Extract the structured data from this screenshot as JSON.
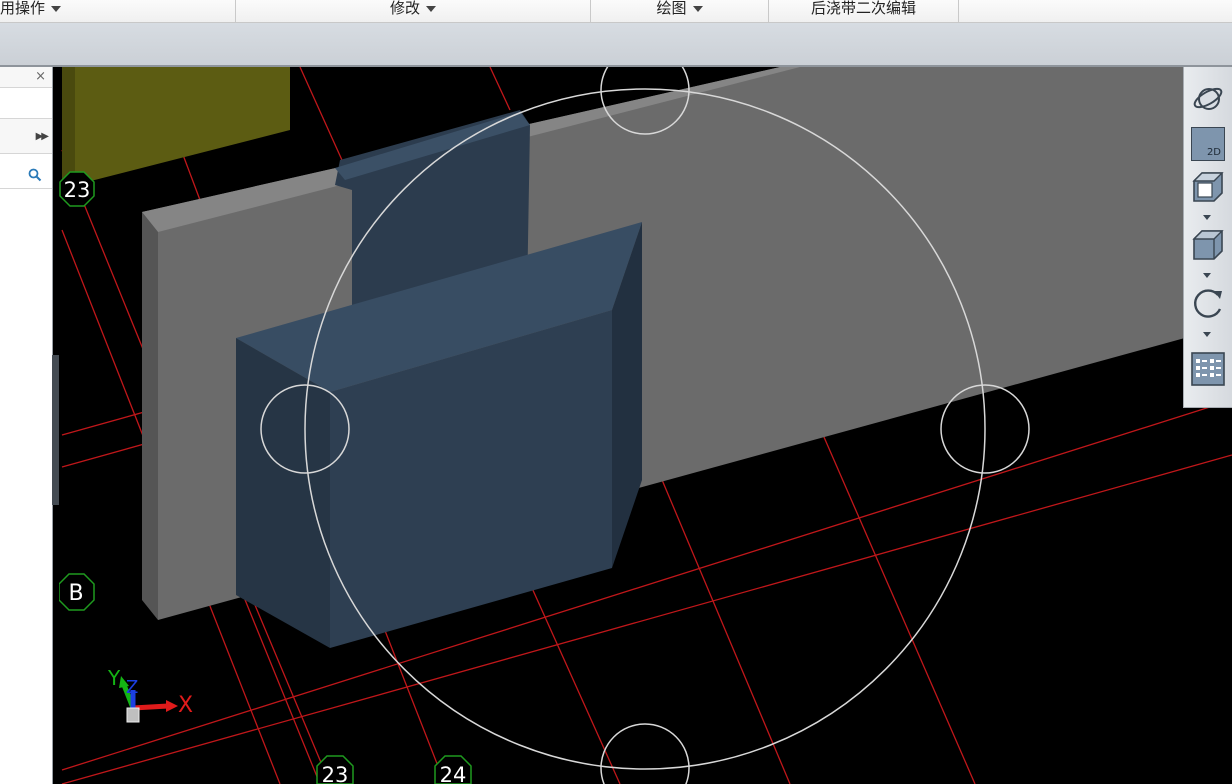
{
  "menubar": {
    "items": [
      {
        "label": "用操作",
        "has_dropdown": true
      },
      {
        "label": "修改",
        "has_dropdown": true
      },
      {
        "label": "绘图",
        "has_dropdown": true
      },
      {
        "label": "后浇带二次编辑",
        "has_dropdown": false
      }
    ]
  },
  "left_panel": {
    "close_label": "×",
    "expand_icon": "double-chevron-right-icon",
    "search_icon": "search-icon"
  },
  "viewport": {
    "grid_markers": {
      "top_left": "23",
      "row_b": "B",
      "bottom_23": "23",
      "bottom_24": "24"
    },
    "axes": {
      "x": "X",
      "y": "Y",
      "z": "Z"
    },
    "colors": {
      "background": "#000000",
      "grid_line": "#c0171a",
      "wall": "#6b6b6b",
      "column": "#34475b",
      "slab": "#5c5c12",
      "orbit_ring": "#d8d8d8",
      "marker": "#1f9a1f"
    }
  },
  "view_toolbar": {
    "buttons": [
      {
        "name": "orbit-icon"
      },
      {
        "name": "view-2d-icon",
        "label": "2D"
      },
      {
        "name": "view-3d-box-icon"
      },
      {
        "name": "cube-icon"
      },
      {
        "name": "rotate-icon"
      },
      {
        "name": "checklist-icon"
      }
    ]
  }
}
